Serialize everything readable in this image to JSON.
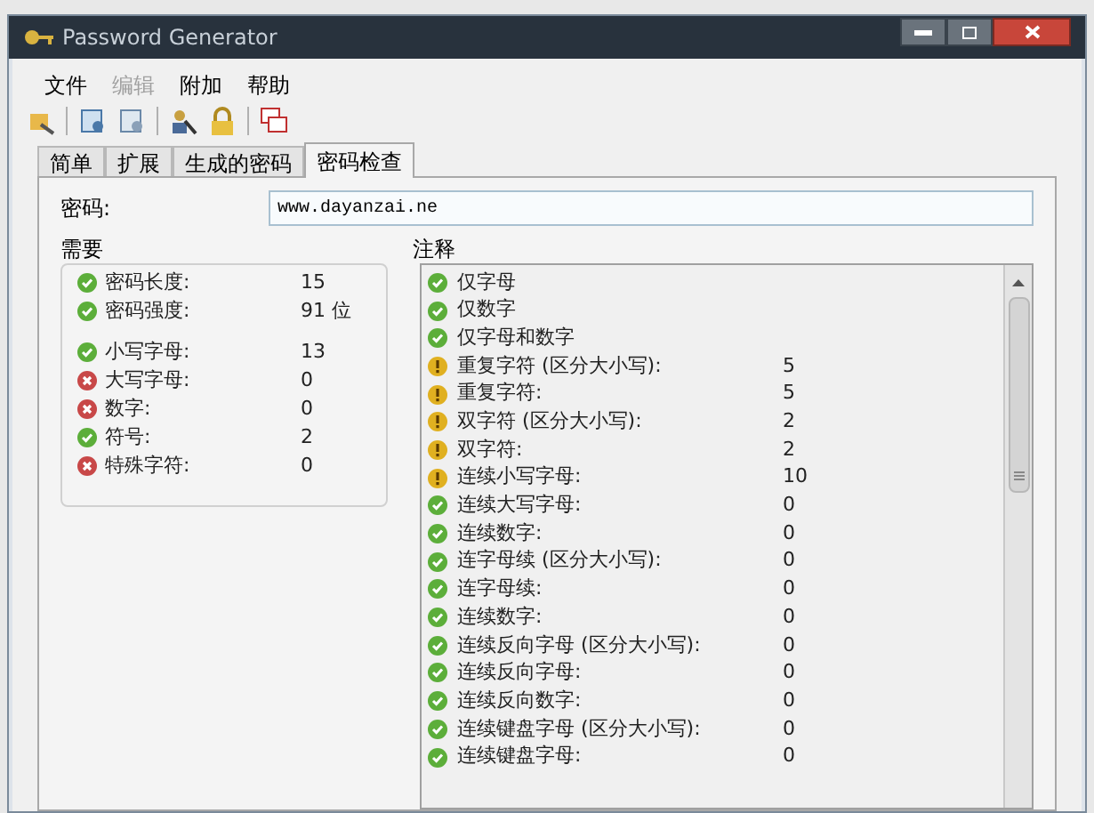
{
  "window": {
    "title": "Password Generator"
  },
  "menu": [
    {
      "label": "文件",
      "disabled": false
    },
    {
      "label": "编辑",
      "disabled": true
    },
    {
      "label": "附加",
      "disabled": false
    },
    {
      "label": "帮助",
      "disabled": false
    }
  ],
  "tabs": [
    {
      "label": "简单",
      "selected": false
    },
    {
      "label": "扩展",
      "selected": false
    },
    {
      "label": "生成的密码",
      "selected": false
    },
    {
      "label": "密码检查",
      "selected": true
    }
  ],
  "password": {
    "label": "密码:",
    "value": "www.dayanzai.ne"
  },
  "requirements": {
    "title": "需要",
    "groups": [
      {
        "items": [
          {
            "kind": "ok",
            "label": "密码长度:",
            "value": "15"
          },
          {
            "kind": "ok",
            "label": "密码强度:",
            "value": "91 位"
          }
        ]
      },
      {
        "items": [
          {
            "kind": "ok",
            "label": "小写字母:",
            "value": "13"
          },
          {
            "kind": "fail",
            "label": "大写字母:",
            "value": "0"
          },
          {
            "kind": "fail",
            "label": "数字:",
            "value": "0"
          },
          {
            "kind": "ok",
            "label": "符号:",
            "value": "2"
          },
          {
            "kind": "fail",
            "label": "特殊字符:",
            "value": "0"
          }
        ]
      }
    ]
  },
  "notes": {
    "title": "注释",
    "items": [
      {
        "kind": "ok",
        "label": "仅字母"
      },
      {
        "kind": "ok",
        "label": "仅数字"
      },
      {
        "kind": "ok",
        "label": "仅字母和数字"
      },
      {
        "kind": "warn",
        "label": "重复字符 (区分大小写):",
        "value": "5"
      },
      {
        "kind": "warn",
        "label": "重复字符:",
        "value": "5"
      },
      {
        "kind": "warn",
        "label": "双字符 (区分大小写):",
        "value": "2"
      },
      {
        "kind": "warn",
        "label": "双字符:",
        "value": "2"
      },
      {
        "kind": "warn",
        "label": "连续小写字母:",
        "value": "10"
      },
      {
        "kind": "ok",
        "label": "连续大写字母:",
        "value": "0"
      },
      {
        "kind": "ok",
        "label": "连续数字:",
        "value": "0"
      },
      {
        "kind": "ok",
        "label": "连字母续 (区分大小写):",
        "value": "0"
      },
      {
        "kind": "ok",
        "label": "连字母续:",
        "value": "0"
      },
      {
        "kind": "ok",
        "label": "连续数字:",
        "value": "0"
      },
      {
        "kind": "ok",
        "label": "连续反向字母 (区分大小写):",
        "value": "0"
      },
      {
        "kind": "ok",
        "label": "连续反向字母:",
        "value": "0"
      },
      {
        "kind": "ok",
        "label": "连续反向数字:",
        "value": "0"
      },
      {
        "kind": "ok",
        "label": "连续键盘字母 (区分大小写):",
        "value": "0"
      },
      {
        "kind": "ok",
        "label": "连续键盘字母:",
        "value": "0"
      }
    ]
  }
}
